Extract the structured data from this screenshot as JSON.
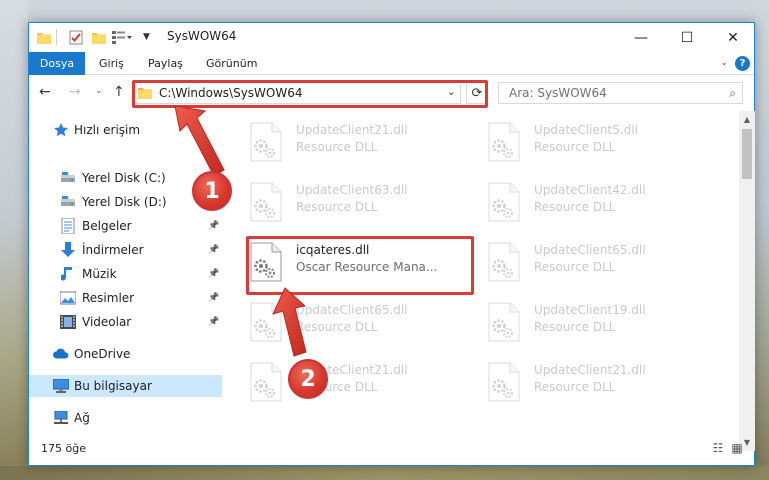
{
  "window": {
    "title": "SysWOW64",
    "controls": {
      "minimize": "—",
      "maximize": "☐",
      "close": "✕"
    }
  },
  "ribbon": {
    "file_tab": "Dosya",
    "tabs": [
      "Giriş",
      "Paylaş",
      "Görünüm"
    ],
    "help": "?"
  },
  "address": {
    "path": "C:\\Windows\\SysWOW64",
    "search_placeholder": "Ara: SysWOW64"
  },
  "sidebar": {
    "items": [
      {
        "label": "Hızlı erişim",
        "icon": "star-icon",
        "pinned": false
      },
      {
        "label": "Yerel Disk (C:)",
        "icon": "drive-icon",
        "pinned": true
      },
      {
        "label": "Yerel Disk (D:)",
        "icon": "drive-icon",
        "pinned": true
      },
      {
        "label": "Belgeler",
        "icon": "documents-icon",
        "pinned": true
      },
      {
        "label": "İndirmeler",
        "icon": "download-icon",
        "pinned": true
      },
      {
        "label": "Müzik",
        "icon": "music-icon",
        "pinned": true
      },
      {
        "label": "Resimler",
        "icon": "pictures-icon",
        "pinned": true
      },
      {
        "label": "Videolar",
        "icon": "videos-icon",
        "pinned": true
      },
      {
        "label": "OneDrive",
        "icon": "cloud-icon",
        "pinned": false
      },
      {
        "label": "Bu bilgisayar",
        "icon": "computer-icon",
        "pinned": false,
        "selected": true
      },
      {
        "label": "Ağ",
        "icon": "network-icon",
        "pinned": false
      }
    ]
  },
  "files": [
    {
      "name": "UpdateClient21.dll",
      "desc": "Resource DLL",
      "highlighted": false
    },
    {
      "name": "UpdateClient5.dll",
      "desc": "Resource DLL",
      "highlighted": false
    },
    {
      "name": "UpdateClient63.dll",
      "desc": "Resource DLL",
      "highlighted": false
    },
    {
      "name": "UpdateClient42.dll",
      "desc": "Resource DLL",
      "highlighted": false
    },
    {
      "name": "icqateres.dll",
      "desc": "Oscar Resource Mana...",
      "highlighted": true
    },
    {
      "name": "UpdateClient65.dll",
      "desc": "Resource DLL",
      "highlighted": false
    },
    {
      "name": "UpdateClient65.dll",
      "desc": "Resource DLL",
      "highlighted": false
    },
    {
      "name": "UpdateClient19.dll",
      "desc": "Resource DLL",
      "highlighted": false
    },
    {
      "name": "UpdateClient21.dll",
      "desc": "Resource DLL",
      "highlighted": false
    },
    {
      "name": "UpdateClient21.dll",
      "desc": "Resource DLL",
      "highlighted": false
    }
  ],
  "status": {
    "count": "175 öğe"
  },
  "annotations": {
    "step1": "1",
    "step2": "2",
    "color": "#d93a3a"
  }
}
